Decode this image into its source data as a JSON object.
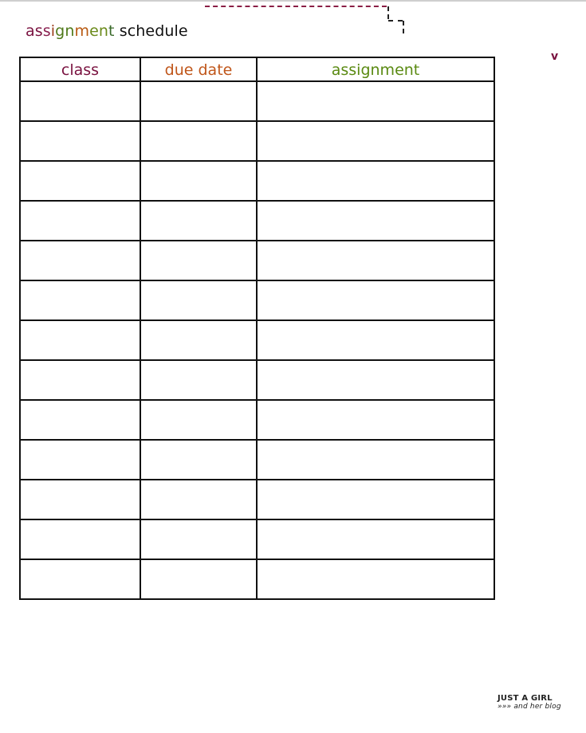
{
  "document": {
    "title_letters": [
      {
        "ch": "a",
        "color": "#7a1240"
      },
      {
        "ch": "s",
        "color": "#7a1240"
      },
      {
        "ch": "s",
        "color": "#8a2050"
      },
      {
        "ch": "i",
        "color": "#9b3d1a"
      },
      {
        "ch": "g",
        "color": "#4f7a1a"
      },
      {
        "ch": "n",
        "color": "#4f7a1a"
      },
      {
        "ch": "m",
        "color": "#b85a12"
      },
      {
        "ch": "e",
        "color": "#6a8a1a"
      },
      {
        "ch": "n",
        "color": "#6a8a1a"
      },
      {
        "ch": "t",
        "color": "#3a6a2a"
      },
      {
        "ch": " schedule",
        "color": "#111111"
      }
    ],
    "title": "assignment schedule",
    "chevron_glyph": "v",
    "logo_line1": "JUST A GIRL",
    "logo_line2": "»»» and her blog"
  },
  "table": {
    "columns": [
      {
        "label": "class",
        "color": "#7a1240"
      },
      {
        "label": "due date",
        "color": "#c0561a"
      },
      {
        "label": "assignment",
        "color": "#5a8a12"
      }
    ],
    "rows": [
      [
        "",
        "",
        ""
      ],
      [
        "",
        "",
        ""
      ],
      [
        "",
        "",
        ""
      ],
      [
        "",
        "",
        ""
      ],
      [
        "",
        "",
        ""
      ],
      [
        "",
        "",
        ""
      ],
      [
        "",
        "",
        ""
      ],
      [
        "",
        "",
        ""
      ],
      [
        "",
        "",
        ""
      ],
      [
        "",
        "",
        ""
      ],
      [
        "",
        "",
        ""
      ],
      [
        "",
        "",
        ""
      ],
      [
        "",
        "",
        ""
      ]
    ]
  }
}
